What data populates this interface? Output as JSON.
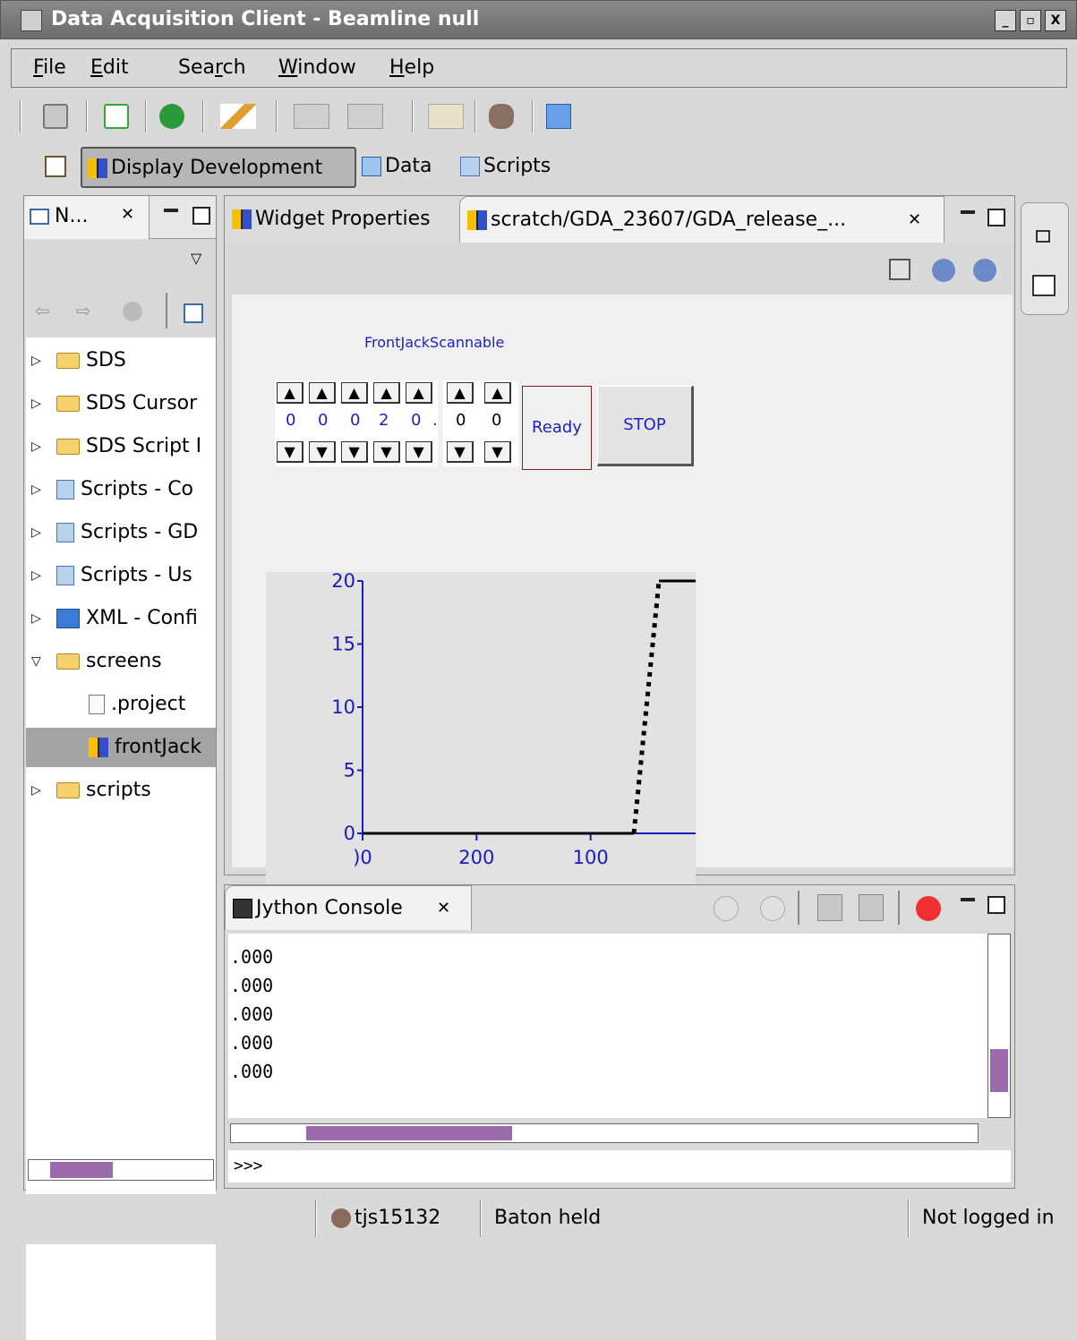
{
  "window": {
    "title": "Data Acquisition Client - Beamline null",
    "buttons": [
      "_",
      "▫",
      "X"
    ]
  },
  "menu": [
    {
      "pre": "",
      "u": "F",
      "post": "ile"
    },
    {
      "pre": "",
      "u": "E",
      "post": "dit"
    },
    {
      "pre": "Sea",
      "u": "r",
      "post": "ch"
    },
    {
      "pre": "",
      "u": "W",
      "post": "indow"
    },
    {
      "pre": "",
      "u": "H",
      "post": "elp"
    }
  ],
  "perspectives": {
    "display_development": "Display Development",
    "data": "Data",
    "scripts": "Scripts"
  },
  "navigator": {
    "tab_label": "N...",
    "items": [
      {
        "label": "SDS",
        "type": "folder",
        "expanded": false
      },
      {
        "label": "SDS Cursor",
        "type": "folder",
        "expanded": false
      },
      {
        "label": "SDS Script I",
        "type": "folder",
        "expanded": false
      },
      {
        "label": "Scripts - Co",
        "type": "script",
        "expanded": false
      },
      {
        "label": "Scripts - GD",
        "type": "script",
        "expanded": false
      },
      {
        "label": "Scripts - Us",
        "type": "script",
        "expanded": false
      },
      {
        "label": "XML - Confi",
        "type": "xml",
        "expanded": false
      },
      {
        "label": "screens",
        "type": "folder",
        "expanded": true
      },
      {
        "label": ".project",
        "type": "file",
        "child": true
      },
      {
        "label": "frontJack",
        "type": "grid",
        "child": true,
        "selected": true
      },
      {
        "label": "scripts",
        "type": "folder",
        "expanded": false
      }
    ]
  },
  "editor": {
    "tabs": {
      "widget_properties": "Widget Properties",
      "screen_file": "scratch/GDA_23607/GDA_release_..."
    },
    "widget": {
      "title": "FrontJackScannable",
      "digits": [
        "0",
        "0",
        "0",
        "2",
        "0",
        ".",
        "0",
        "0"
      ],
      "status": "Ready",
      "stop": "STOP"
    }
  },
  "chart_data": {
    "type": "line",
    "title": "",
    "xlabel": "",
    "ylabel": "",
    "ylim": [
      0,
      20
    ],
    "y_ticks": [
      "0",
      "5",
      "10",
      "15",
      "20"
    ],
    "x_ticks": [
      ")0",
      "200",
      "100",
      "("
    ],
    "x_reversed": true,
    "series": [
      {
        "x": [
          300,
          100
        ],
        "y": [
          0,
          0
        ],
        "style": "solid"
      },
      {
        "x": [
          100,
          62
        ],
        "y": [
          0,
          0
        ],
        "style": "solid"
      },
      {
        "x": [
          62,
          40
        ],
        "y": [
          0,
          20
        ],
        "style": "dotted"
      },
      {
        "x": [
          40,
          0
        ],
        "y": [
          20,
          20
        ],
        "style": "solid"
      }
    ]
  },
  "console": {
    "tab_label": "Jython Console",
    "output_lines": [
      ".000",
      ".000",
      ".000",
      ".000",
      ".000"
    ],
    "prompt": ">>>"
  },
  "status": {
    "user": "tjs15132",
    "baton": "Baton held",
    "login": "Not logged in"
  }
}
